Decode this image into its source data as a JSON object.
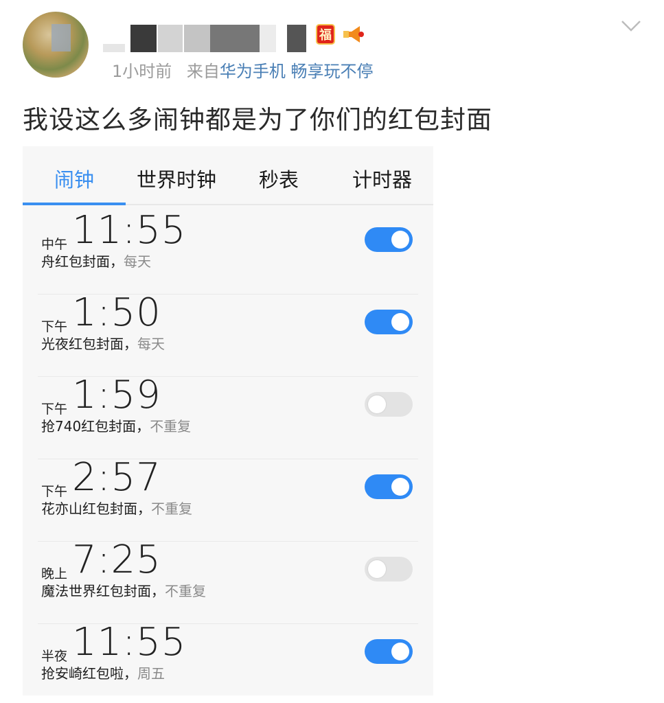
{
  "post": {
    "username_badge_fu": "福",
    "time_ago": "1小时前",
    "from_prefix": "来自",
    "source": "华为手机 畅享玩不停",
    "text": "我设这么多闹钟都是为了你们的红包封面"
  },
  "clock_app": {
    "tabs": [
      {
        "label": "闹钟",
        "active": true
      },
      {
        "label": "世界时钟",
        "active": false
      },
      {
        "label": "秒表",
        "active": false
      },
      {
        "label": "计时器",
        "active": false
      }
    ],
    "alarms": [
      {
        "period": "中午",
        "time": "11:55",
        "label": "舟红包封面，",
        "repeat": "每天",
        "enabled": true
      },
      {
        "period": "下午",
        "time": "1:50",
        "label": "光夜红包封面，",
        "repeat": "每天",
        "enabled": true
      },
      {
        "period": "下午",
        "time": "1:59",
        "label": "抢740红包封面，",
        "repeat": "不重复",
        "enabled": false
      },
      {
        "period": "下午",
        "time": "2:57",
        "label": "花亦山红包封面，",
        "repeat": "不重复",
        "enabled": true
      },
      {
        "period": "晚上",
        "time": "7:25",
        "label": "魔法世界红包封面，",
        "repeat": "不重复",
        "enabled": false
      },
      {
        "period": "半夜",
        "time": "11:55",
        "label": "抢安崎红包啦，",
        "repeat": "周五",
        "enabled": true
      }
    ]
  },
  "colors": {
    "accent": "#3a8ff0",
    "toggle_on": "#2f8af5",
    "toggle_off": "#e3e3e3",
    "link": "#4a7fb5"
  },
  "icons": {
    "chevron": "chevron-down-icon",
    "horn": "megaphone-icon",
    "fu": "fu-badge-icon"
  }
}
